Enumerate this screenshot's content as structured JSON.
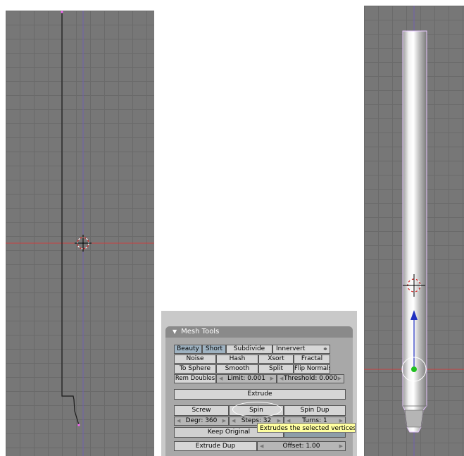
{
  "panel": {
    "title": "Mesh Tools",
    "row1": [
      "Beauty",
      "Short",
      "Subdivide",
      "Innervert"
    ],
    "row2": [
      "Noise",
      "Hash",
      "Xsort",
      "Fractal"
    ],
    "row3": [
      "To Sphere",
      "Smooth",
      "Split",
      "Flip Normals"
    ],
    "row4": {
      "rem_doubles": "Rem Doubles",
      "limit": "Limit: 0.001",
      "threshold": "Threshold: 0.000"
    },
    "extrude": "Extrude",
    "row6": [
      "Screw",
      "Spin",
      "Spin Dup"
    ],
    "row7": {
      "degr": "Degr: 360",
      "steps": "Steps: 32",
      "turns": "Turns: 1"
    },
    "keep_original": "Keep Original",
    "extrude_dup": "Extrude Dup",
    "offset": "Offset: 1.00",
    "tooltip": "Extrudes the selected vertices in"
  },
  "colors": {
    "viewport_bg": "#777777",
    "grid": "#6a6a6a",
    "x_axis": "#c84040",
    "z_axis": "#7060b0",
    "tooltip_bg": "#ffffa0",
    "active_button": "#9fb3c2"
  },
  "icons": [
    "cursor-icon",
    "manipulator-arrow-icon",
    "manipulator-center-icon",
    "dropdown-arrow-icon"
  ]
}
